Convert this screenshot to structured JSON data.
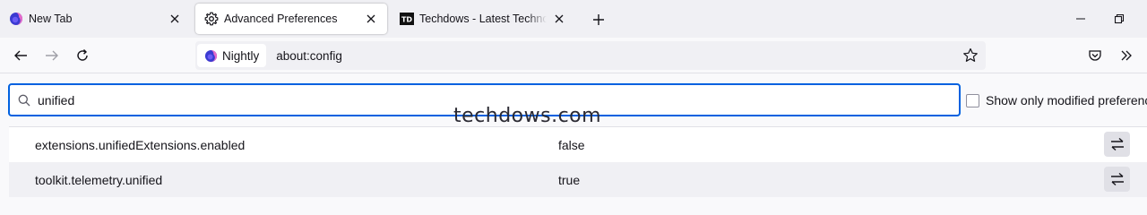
{
  "tabs": [
    {
      "label": "New Tab",
      "icon": "nightly-logo-icon"
    },
    {
      "label": "Advanced Preferences",
      "icon": "gear-icon"
    },
    {
      "label": "Techdows - Latest Technology N",
      "icon": "techdows-logo-icon"
    }
  ],
  "urlbar": {
    "identity_label": "Nightly",
    "url": "about:config"
  },
  "search": {
    "value": "unified"
  },
  "modified_toggle": {
    "label": "Show only modified preferences"
  },
  "watermark": "techdows.com",
  "prefs": [
    {
      "name": "extensions.unifiedExtensions.enabled",
      "value": "false"
    },
    {
      "name": "toolkit.telemetry.unified",
      "value": "true"
    }
  ],
  "colors": {
    "accent": "#0061e0",
    "tabstrip": "#f0f0f4",
    "row_alt": "#f0f0f4"
  }
}
